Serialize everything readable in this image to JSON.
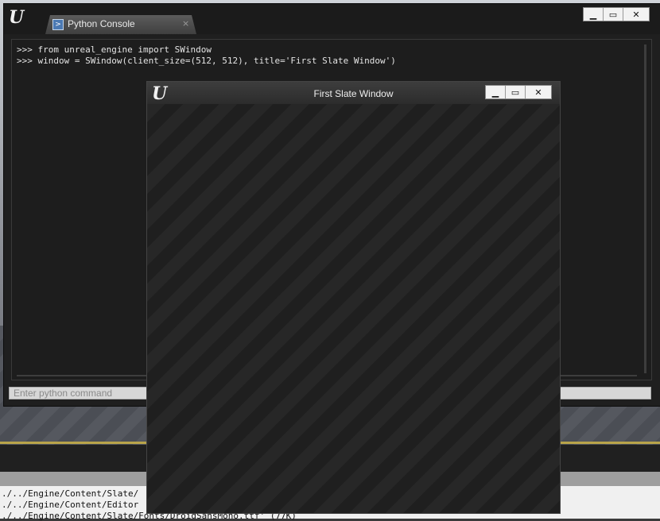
{
  "background": {
    "log_lines": [
      "./../Engine/Content/Slate/",
      "./../Engine/Content/Editor",
      "./../Engine/Content/Slate/Fonts/DroidSansMono.ttf' (77K)"
    ]
  },
  "console": {
    "logo_text": "U",
    "tab_label": "Python Console",
    "tab_icon_glyph": ">",
    "tab_close_glyph": "×",
    "window_buttons": {
      "minimize": "▁",
      "maximize": "▭",
      "close": "✕"
    },
    "output_lines": [
      ">>> from unreal_engine import SWindow",
      ">>> window = SWindow(client_size=(512, 512), title='First Slate Window')"
    ],
    "input_placeholder": "Enter python command",
    "input_value": ""
  },
  "slate_window": {
    "logo_text": "U",
    "title": "First Slate Window",
    "window_buttons": {
      "minimize": "▁",
      "maximize": "▭",
      "close": "✕"
    }
  },
  "colors": {
    "console_bg": "#1f1f1f",
    "slate_stripe_a": "#272727",
    "slate_stripe_b": "#1f1f1f",
    "input_bg": "#d7d7d7"
  }
}
